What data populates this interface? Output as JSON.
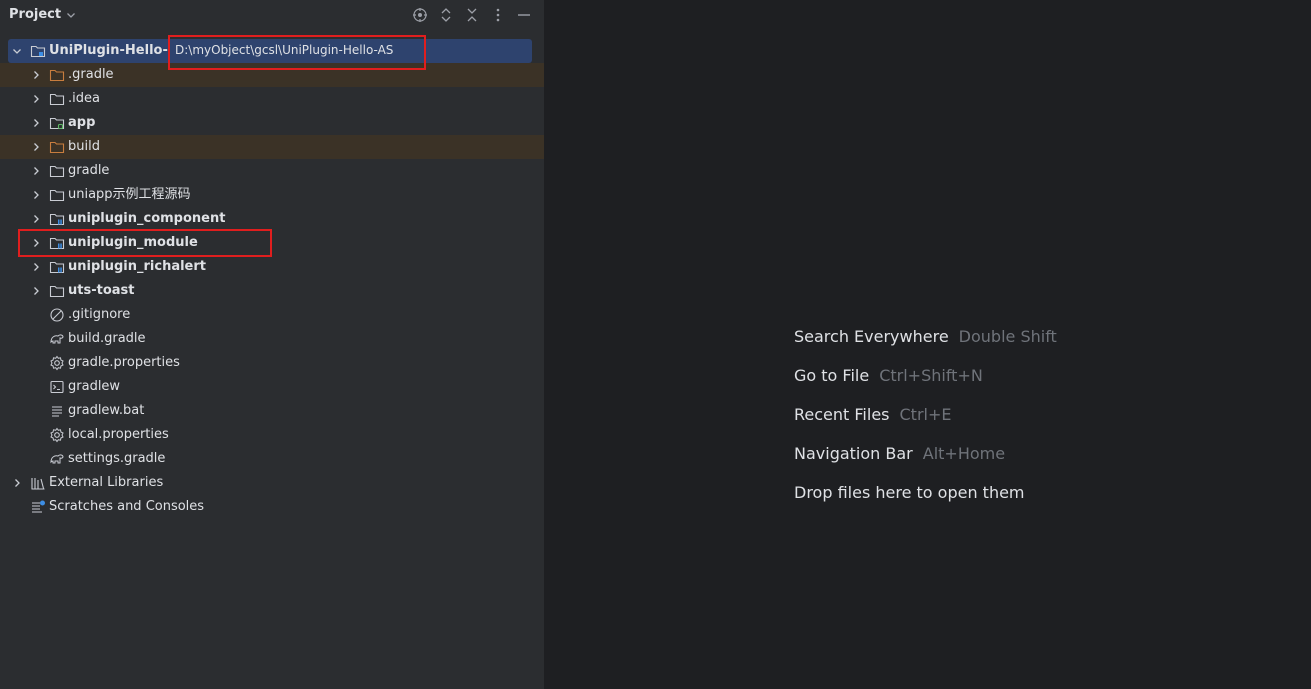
{
  "panel": {
    "title": "Project",
    "header_icons": [
      "target-icon",
      "expand-all-icon",
      "collapse-all-icon",
      "more-options-icon",
      "minimize-icon"
    ]
  },
  "tree": {
    "root": {
      "label": "UniPlugin-Hello-AS",
      "path": "D:\\myObject\\gcsl\\UniPlugin-Hello-AS"
    },
    "items": [
      {
        "label": ".gradle",
        "icon": "folder-orange-icon",
        "bold": false,
        "arrow": true,
        "excluded": true
      },
      {
        "label": ".idea",
        "icon": "folder-icon",
        "bold": false,
        "arrow": true,
        "excluded": false
      },
      {
        "label": "app",
        "icon": "module-folder-icon",
        "bold": true,
        "arrow": true,
        "excluded": false
      },
      {
        "label": "build",
        "icon": "folder-orange-icon",
        "bold": false,
        "arrow": true,
        "excluded": true
      },
      {
        "label": "gradle",
        "icon": "folder-icon",
        "bold": false,
        "arrow": true,
        "excluded": false
      },
      {
        "label": "uniapp示例工程源码",
        "icon": "folder-icon",
        "bold": false,
        "arrow": true,
        "excluded": false
      },
      {
        "label": "uniplugin_component",
        "icon": "library-folder-icon",
        "bold": true,
        "arrow": true,
        "excluded": false
      },
      {
        "label": "uniplugin_module",
        "icon": "library-folder-icon",
        "bold": true,
        "arrow": true,
        "excluded": false
      },
      {
        "label": "uniplugin_richalert",
        "icon": "library-folder-icon",
        "bold": true,
        "arrow": true,
        "excluded": false
      },
      {
        "label": "uts-toast",
        "icon": "folder-icon",
        "bold": true,
        "arrow": true,
        "excluded": false
      },
      {
        "label": ".gitignore",
        "icon": "ignore-file-icon",
        "bold": false,
        "arrow": false,
        "excluded": false
      },
      {
        "label": "build.gradle",
        "icon": "gradle-file-icon",
        "bold": false,
        "arrow": false,
        "excluded": false
      },
      {
        "label": "gradle.properties",
        "icon": "gear-icon",
        "bold": false,
        "arrow": false,
        "excluded": false
      },
      {
        "label": "gradlew",
        "icon": "terminal-file-icon",
        "bold": false,
        "arrow": false,
        "excluded": false
      },
      {
        "label": "gradlew.bat",
        "icon": "text-file-icon",
        "bold": false,
        "arrow": false,
        "excluded": false
      },
      {
        "label": "local.properties",
        "icon": "gear-icon",
        "bold": false,
        "arrow": false,
        "excluded": false
      },
      {
        "label": "settings.gradle",
        "icon": "gradle-file-icon",
        "bold": false,
        "arrow": false,
        "excluded": false
      }
    ],
    "external_libraries": "External Libraries",
    "scratches": "Scratches and Consoles"
  },
  "editor": {
    "hints": [
      {
        "action": "Search Everywhere",
        "shortcut": "Double Shift"
      },
      {
        "action": "Go to File",
        "shortcut": "Ctrl+Shift+N"
      },
      {
        "action": "Recent Files",
        "shortcut": "Ctrl+E"
      },
      {
        "action": "Navigation Bar",
        "shortcut": "Alt+Home"
      },
      {
        "action": "Drop files here to open them",
        "shortcut": ""
      }
    ]
  },
  "colors": {
    "panel_bg": "#2b2d30",
    "editor_bg": "#1e1f22",
    "selection": "#2e436e",
    "excluded_row": "#3b3226",
    "highlight_box": "#e01e1e"
  }
}
